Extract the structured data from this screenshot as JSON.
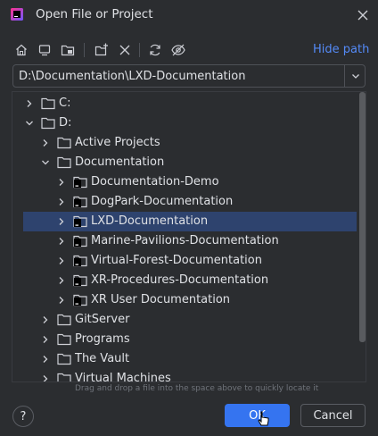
{
  "dialog": {
    "title": "Open File or Project",
    "hide_path": "Hide path",
    "path_value": "D:\\Documentation\\LXD-Documentation",
    "hint": "Drag and drop a file into the space above to quickly locate it",
    "ok_label": "OK",
    "cancel_label": "Cancel",
    "help_label": "?"
  },
  "tree": {
    "rows": [
      {
        "label": "C:",
        "level": 0,
        "expanded": false,
        "icon": "drive-icon"
      },
      {
        "label": "D:",
        "level": 0,
        "expanded": true,
        "icon": "drive-icon"
      },
      {
        "label": "Active Projects",
        "level": 1,
        "expanded": false,
        "icon": "folder-icon"
      },
      {
        "label": "Documentation",
        "level": 1,
        "expanded": true,
        "icon": "folder-icon"
      },
      {
        "label": "Documentation-Demo",
        "level": 2,
        "expanded": false,
        "icon": "project-folder-icon"
      },
      {
        "label": "DogPark-Documentation",
        "level": 2,
        "expanded": false,
        "icon": "project-folder-icon"
      },
      {
        "label": "LXD-Documentation",
        "level": 2,
        "expanded": false,
        "icon": "project-folder-icon",
        "selected": true
      },
      {
        "label": "Marine-Pavilions-Documentation",
        "level": 2,
        "expanded": false,
        "icon": "project-folder-icon"
      },
      {
        "label": "Virtual-Forest-Documentation",
        "level": 2,
        "expanded": false,
        "icon": "project-folder-icon"
      },
      {
        "label": "XR-Procedures-Documentation",
        "level": 2,
        "expanded": false,
        "icon": "project-folder-icon"
      },
      {
        "label": "XR User Documentation",
        "level": 2,
        "expanded": false,
        "icon": "project-folder-icon"
      },
      {
        "label": "GitServer",
        "level": 1,
        "expanded": false,
        "icon": "folder-icon"
      },
      {
        "label": "Programs",
        "level": 1,
        "expanded": false,
        "icon": "folder-icon"
      },
      {
        "label": "The Vault",
        "level": 1,
        "expanded": false,
        "icon": "folder-icon"
      },
      {
        "label": "Virtual Machines",
        "level": 1,
        "expanded": false,
        "icon": "folder-icon"
      }
    ]
  },
  "toolbar": {
    "buttons": [
      "home-icon",
      "desktop-icon",
      "project-directory-icon",
      "new-folder-icon",
      "delete-icon",
      "refresh-icon",
      "show-hidden-icon"
    ]
  },
  "colors": {
    "background": "#2b2d30",
    "selection": "#2e436e",
    "accent": "#3574f0",
    "link": "#548af7",
    "text": "#dfe1e5"
  }
}
